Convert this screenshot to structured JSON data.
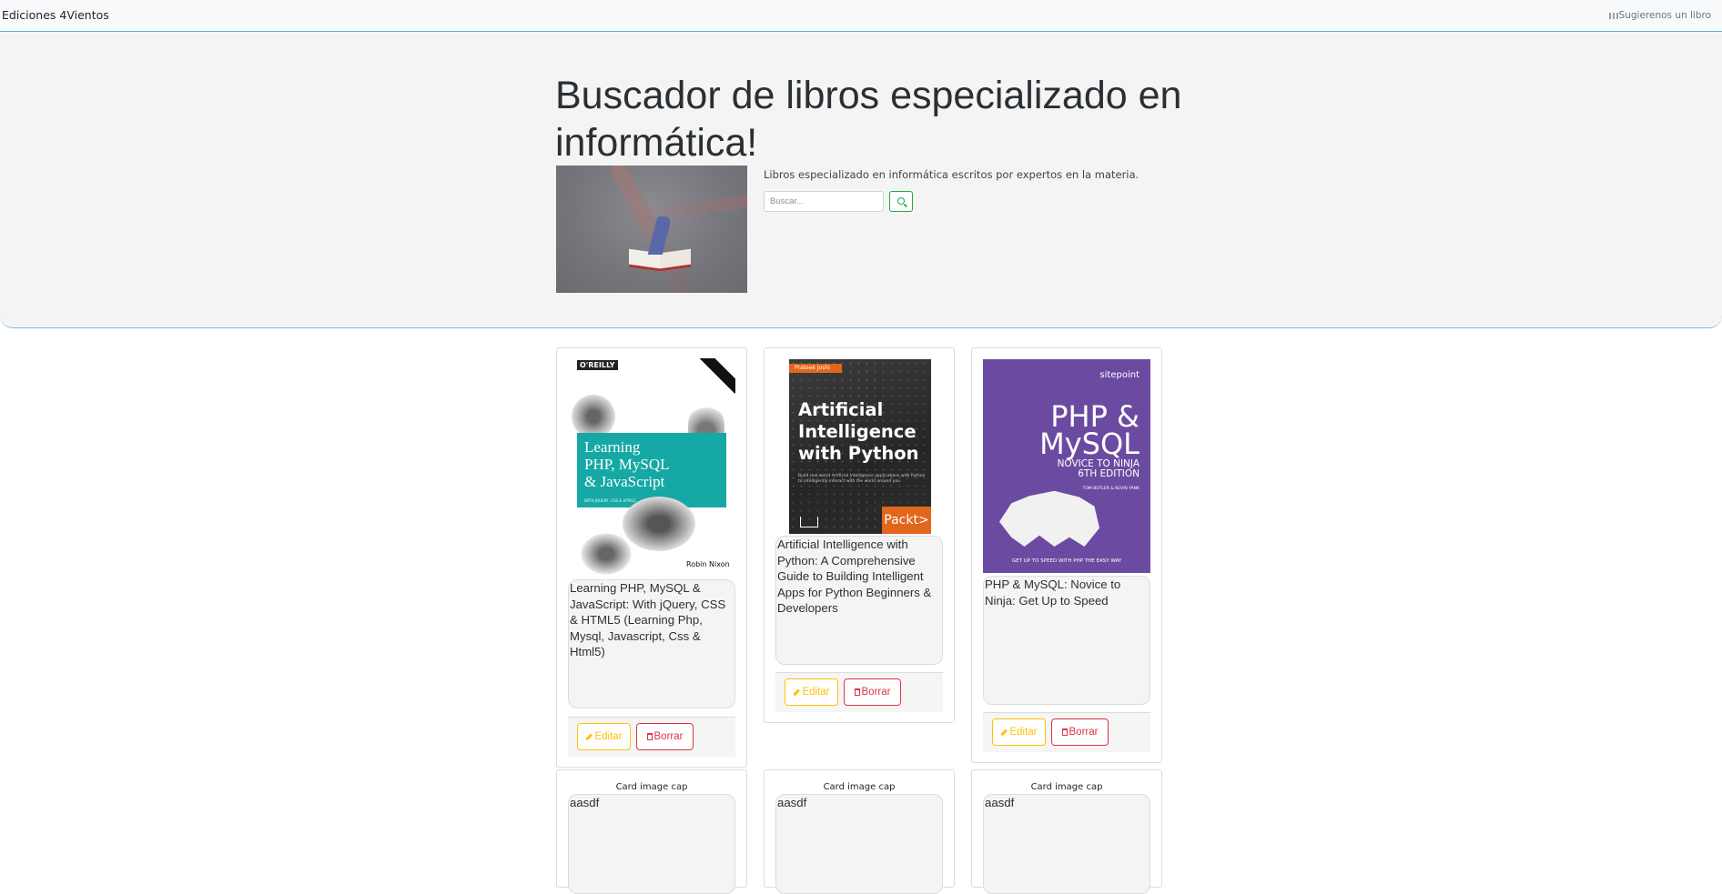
{
  "navbar": {
    "brand": "Ediciones 4Vientos",
    "suggest_icon": "grid-icon",
    "suggest_label": "Sugierenos un libro"
  },
  "hero": {
    "title": "Buscador de libros especializado en informática!",
    "lead": "Libros especializado en informática escritos por expertos en la materia.",
    "search_placeholder": "Buscar...",
    "search_icon": "search-icon"
  },
  "cards": [
    {
      "title": "Learning PHP, MySQL & JavaScript: With jQuery, CSS & HTML5 (Learning Php, Mysql, Javascript, Css & Html5)",
      "cover": {
        "publisher": "O'REILLY",
        "line1": "Learning",
        "line2": "PHP, MySQL",
        "line3": "& JavaScript",
        "subtitle": "WITH JQUERY, CSS & HTML5",
        "author": "Robin Nixon"
      }
    },
    {
      "title": "Artificial Intelligence with Python: A Comprehensive Guide to Building Intelligent Apps for Python Beginners & Developers",
      "cover": {
        "author": "Prateek Joshi",
        "line1": "Artificial",
        "line2": "Intelligence",
        "line3": "with Python",
        "subtitle": "Build real-world Artificial Intelligence applications with Python to intelligently interact with the world around you",
        "publisher": "Packt>"
      }
    },
    {
      "title": "PHP & MySQL: Novice to Ninja: Get Up to Speed",
      "cover": {
        "publisher": "sitepoint",
        "line1": "PHP &",
        "line2": "MySQL",
        "line3": "NOVICE TO NINJA",
        "edition": "6TH EDITION",
        "authors": "TOM BUTLER & KEVIN YANK",
        "footer": "GET UP TO SPEED WITH PHP THE EASY WAY"
      }
    }
  ],
  "buttons": {
    "edit_label": "Editar",
    "delete_label": "Borrar",
    "edit_icon": "pencil-icon",
    "delete_icon": "trash-icon"
  },
  "row2": [
    {
      "cap": "Card image cap",
      "text": "aasdf"
    },
    {
      "cap": "Card image cap",
      "text": "aasdf"
    },
    {
      "cap": "Card image cap",
      "text": "aasdf"
    }
  ]
}
